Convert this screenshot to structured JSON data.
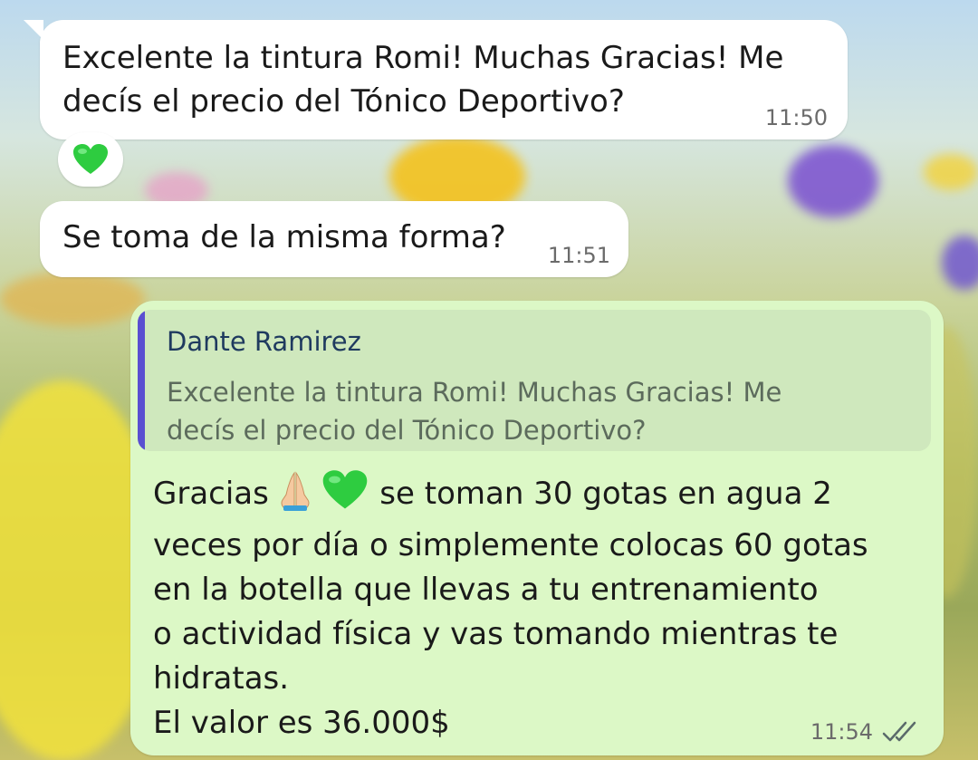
{
  "messages": [
    {
      "direction": "incoming",
      "text_lines": [
        "Excelente la tintura Romi! Muchas Gracias! Me",
        "decís el precio del Tónico Deportivo?"
      ],
      "time": "11:50",
      "reaction": "💚"
    },
    {
      "direction": "incoming",
      "text": "Se toma de la misma forma?",
      "time": "11:51"
    },
    {
      "direction": "outgoing",
      "quote": {
        "author": "Dante Ramirez",
        "text_lines": [
          "Excelente la tintura Romi! Muchas Gracias! Me",
          "decís el precio del Tónico Deportivo?"
        ]
      },
      "text_lines": [
        "Gracias",
        "se toman 30 gotas en agua 2",
        "veces por día o simplemente colocas 60 gotas",
        "en la botella que llevas a tu entrenamiento",
        "o actividad física y vas tomando mientras te",
        "hidratas.",
        "El valor es 36.000$"
      ],
      "emojis": [
        "🙏",
        "💚"
      ],
      "time": "11:54",
      "status": "read-double-check"
    }
  ],
  "colors": {
    "incoming_bubble": "#ffffff",
    "outgoing_bubble": "#dcf8c6",
    "quote_bar": "#5a4fd1",
    "quote_author": "#1f3a5f",
    "heart": "#2ecc40"
  }
}
